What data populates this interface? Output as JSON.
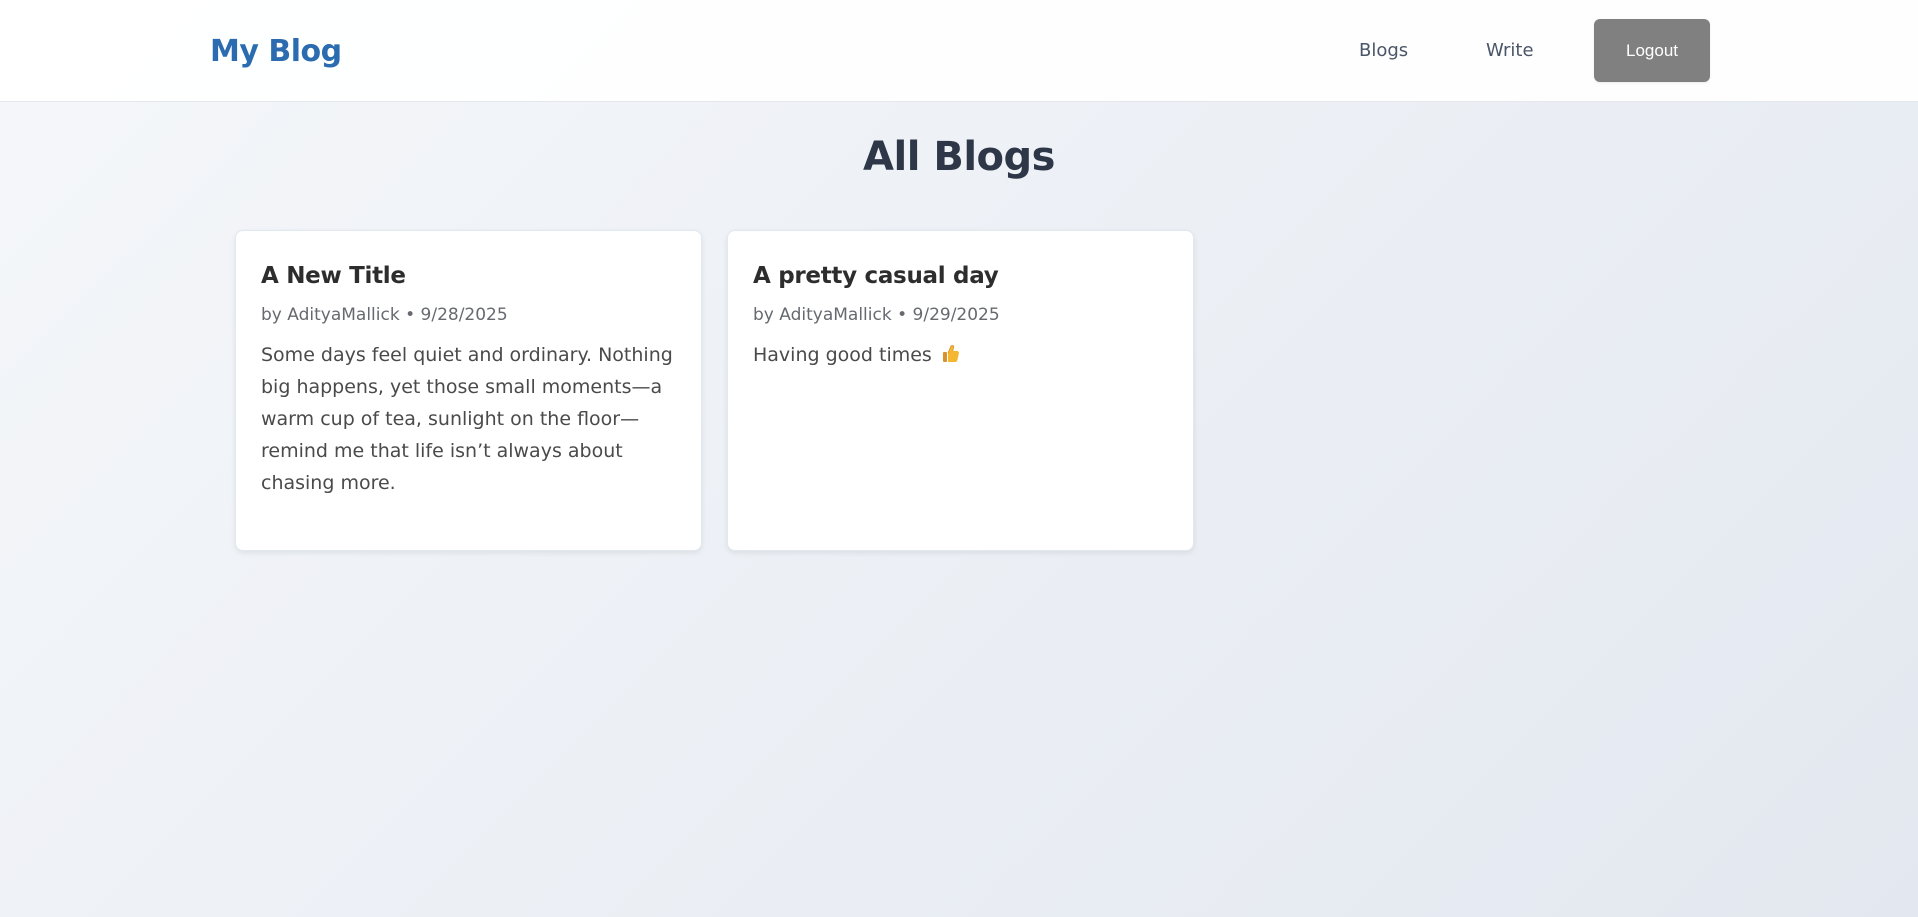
{
  "header": {
    "brand": "My Blog",
    "nav": [
      {
        "label": "Blogs"
      },
      {
        "label": "Write"
      }
    ],
    "logout_label": "Logout"
  },
  "main": {
    "title": "All Blogs",
    "posts": [
      {
        "title": "A New Title",
        "author": "AdityaMallick",
        "date": "9/28/2025",
        "meta": "by AdityaMallick • 9/28/2025",
        "excerpt": "Some days feel quiet and ordinary. Nothing big happens, yet those small moments—a warm cup of tea, sunlight on the floor—remind me that life isn’t always about chasing more."
      },
      {
        "title": "A pretty casual day",
        "author": "AdityaMallick",
        "date": "9/29/2025",
        "meta": "by AdityaMallick • 9/29/2025",
        "excerpt": "Having good times",
        "emoji_icon": "thumbs-up-icon"
      }
    ]
  },
  "colors": {
    "brand": "#2b6cb0",
    "logout_button": "#808080",
    "title_text": "#2d3748"
  }
}
